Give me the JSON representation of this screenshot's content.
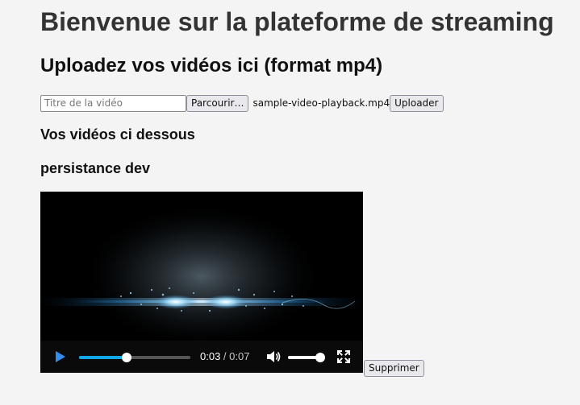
{
  "page": {
    "title": "Bienvenue sur la plateforme de streaming",
    "upload_heading": "Uploadez vos vidéos ici (format mp4)"
  },
  "upload_form": {
    "title_placeholder": "Titre de la vidéo",
    "title_value": "",
    "browse_label": "Parcourir…",
    "selected_file": "sample-video-playback.mp4",
    "upload_label": "Uploader"
  },
  "videos": {
    "heading": "Vos vidéos ci dessous",
    "items": [
      {
        "title": "persistance dev",
        "current_time": "0:03",
        "separator": " / ",
        "duration": "0:07",
        "progress": 0.43,
        "volume": 1.0,
        "delete_label": "Supprimer"
      }
    ]
  },
  "icons": {
    "play": "play-icon",
    "volume": "volume-icon",
    "fullscreen": "fullscreen-icon"
  },
  "colors": {
    "background": "#f4f4f4",
    "progress_accent": "#12a8e8",
    "play_icon": "#2e8ff0"
  }
}
